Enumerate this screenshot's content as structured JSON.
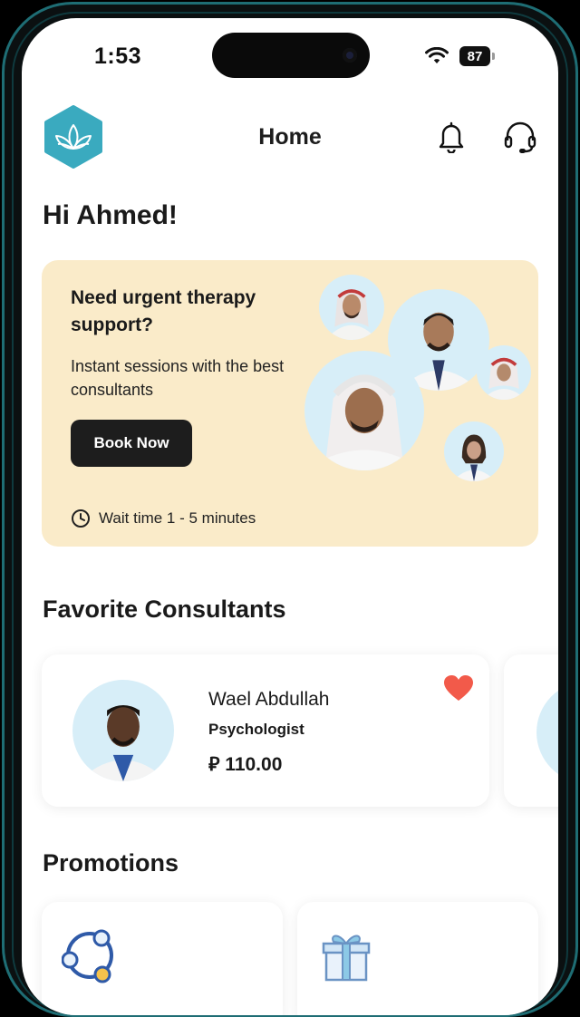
{
  "status_bar": {
    "time": "1:53",
    "battery": "87"
  },
  "header": {
    "title": "Home"
  },
  "greeting": "Hi Ahmed!",
  "banner": {
    "title": "Need urgent therapy support?",
    "subtitle": "Instant sessions with the best consultants",
    "button_label": "Book Now",
    "wait_time": "Wait time 1 - 5 minutes"
  },
  "favorites": {
    "title": "Favorite Consultants",
    "items": [
      {
        "name": "Wael Abdullah",
        "role": "Psychologist",
        "price": "⃁ 110.00",
        "favorited": true
      }
    ]
  },
  "promotions": {
    "title": "Promotions"
  },
  "colors": {
    "accent": "#3aaabf",
    "banner_bg": "#faebc9",
    "heart": "#f25a4a",
    "button": "#1d1d1d"
  },
  "icons": [
    "logo-icon",
    "bell-icon",
    "headset-icon",
    "clock-icon",
    "heart-icon",
    "wifi-icon",
    "network-icon",
    "gift-icon"
  ]
}
